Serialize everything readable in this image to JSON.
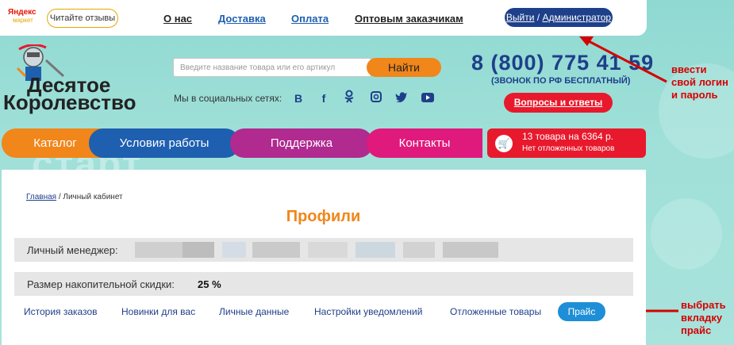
{
  "topbar": {
    "yandex_logo_line1": "Яндекс",
    "yandex_logo_line2": "маркет",
    "reviews_button": "Читайте отзывы",
    "links": [
      "О нас",
      "Доставка",
      "Оплата",
      "Оптовым заказчикам"
    ],
    "logout": "Выйти",
    "separator": "/",
    "user": "Администратор"
  },
  "header": {
    "logo_line1": "Десятое",
    "logo_line2": "Королевство",
    "search_placeholder": "Введите название товара или его артикул",
    "search_button": "Найти",
    "social_label": "Мы в социальных сетях:",
    "social_icons": [
      "vk-icon",
      "facebook-icon",
      "odnoklassniki-icon",
      "instagram-icon",
      "twitter-icon",
      "youtube-icon"
    ],
    "phone": "8 (800) 775 41 59",
    "phone_note": "(ЗВОНОК ПО РФ БЕСПЛАТНЫЙ)",
    "faq_button": "Вопросы и ответы"
  },
  "nav": {
    "items": [
      "Каталог",
      "Условия работы",
      "Поддержка",
      "Контакты"
    ],
    "colors": [
      "#f1861a",
      "#1e5fb0",
      "#b02a8f",
      "#e0197c"
    ]
  },
  "cart": {
    "summary": "13 товара на 6364 р.",
    "deferred": "Нет отложенных товаров"
  },
  "breadcrumb": {
    "home": "Главная",
    "separator": " / ",
    "current": "Личный кабинет"
  },
  "page_title": "Профили",
  "profile": {
    "manager_label": "Личный менеджер:",
    "discount_label": "Размер накопительной скидки:",
    "discount_value": "25 %"
  },
  "tabs": {
    "items": [
      "История заказов",
      "Новинки для вас",
      "Личные данные",
      "Настройки уведомлений",
      "Отложенные товары"
    ],
    "active": "Прайс"
  },
  "annotations": {
    "login": [
      "ввести",
      "свой логин",
      "и пароль"
    ],
    "price": [
      "выбрать",
      "вкладку",
      "прайс"
    ],
    "color": "#d60000"
  }
}
